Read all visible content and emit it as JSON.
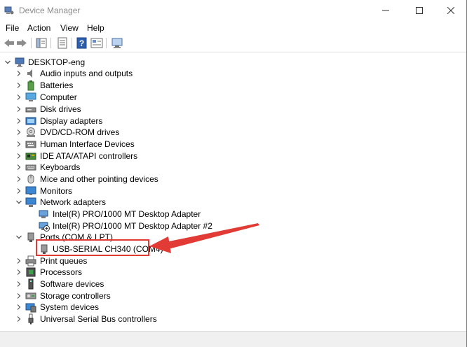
{
  "window": {
    "title": "Device Manager"
  },
  "menu": [
    "File",
    "Action",
    "View",
    "Help"
  ],
  "toolbar": {
    "icons": [
      "back-arrow-icon",
      "forward-arrow-icon",
      "show-hide-tree-icon",
      "properties-icon",
      "help-icon",
      "show-hidden-icon",
      "scan-hardware-icon"
    ]
  },
  "tree": {
    "root": "DESKTOP-eng",
    "items": [
      {
        "label": "Audio inputs and outputs",
        "expanded": false,
        "icon": "speaker-icon"
      },
      {
        "label": "Batteries",
        "expanded": false,
        "icon": "battery-icon"
      },
      {
        "label": "Computer",
        "expanded": false,
        "icon": "computer-icon"
      },
      {
        "label": "Disk drives",
        "expanded": false,
        "icon": "disk-drive-icon"
      },
      {
        "label": "Display adapters",
        "expanded": false,
        "icon": "display-adapter-icon"
      },
      {
        "label": "DVD/CD-ROM drives",
        "expanded": false,
        "icon": "dvd-drive-icon"
      },
      {
        "label": "Human Interface Devices",
        "expanded": false,
        "icon": "hid-icon"
      },
      {
        "label": "IDE ATA/ATAPI controllers",
        "expanded": false,
        "icon": "ide-controller-icon"
      },
      {
        "label": "Keyboards",
        "expanded": false,
        "icon": "keyboard-icon"
      },
      {
        "label": "Mice and other pointing devices",
        "expanded": false,
        "icon": "mouse-icon"
      },
      {
        "label": "Monitors",
        "expanded": false,
        "icon": "monitor-icon"
      },
      {
        "label": "Network adapters",
        "expanded": true,
        "icon": "network-icon",
        "children": [
          "Intel(R) PRO/1000 MT Desktop Adapter",
          "Intel(R) PRO/1000 MT Desktop Adapter #2"
        ]
      },
      {
        "label": "Ports (COM & LPT)",
        "expanded": true,
        "icon": "port-icon",
        "children": [
          "USB-SERIAL CH340 (COM4)"
        ]
      },
      {
        "label": "Print queues",
        "expanded": false,
        "icon": "printer-icon"
      },
      {
        "label": "Processors",
        "expanded": false,
        "icon": "processor-icon"
      },
      {
        "label": "Software devices",
        "expanded": false,
        "icon": "software-device-icon"
      },
      {
        "label": "Storage controllers",
        "expanded": false,
        "icon": "storage-controller-icon"
      },
      {
        "label": "System devices",
        "expanded": false,
        "icon": "system-device-icon"
      },
      {
        "label": "Universal Serial Bus controllers",
        "expanded": false,
        "icon": "usb-icon"
      }
    ]
  },
  "annotation": {
    "highlight_color": "#e23a34"
  }
}
